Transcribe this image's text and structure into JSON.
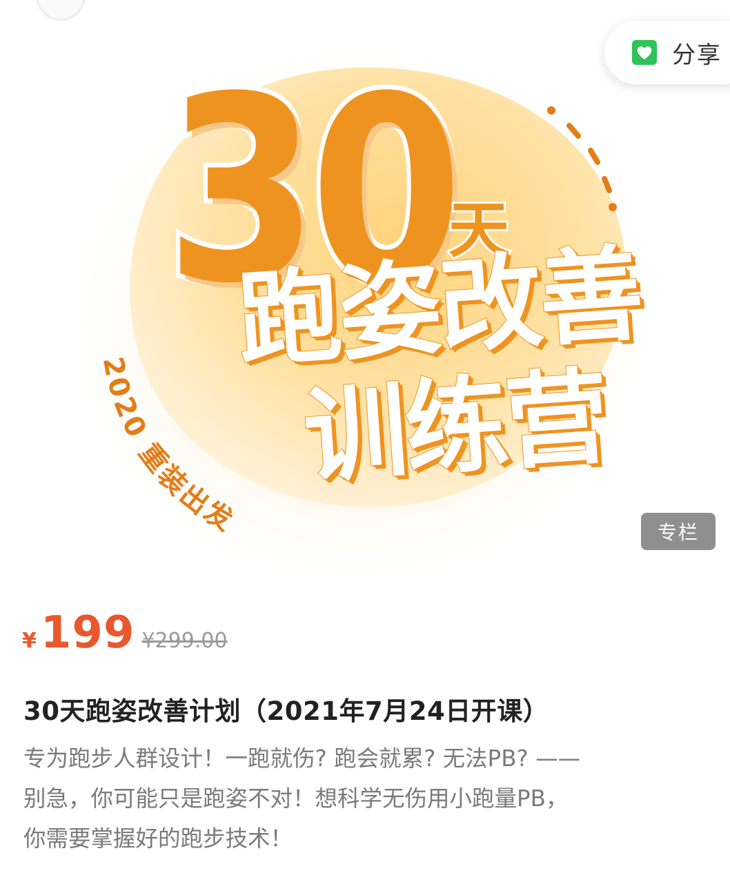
{
  "share": {
    "label": "分享",
    "icon": "green-heart-share-icon"
  },
  "poster": {
    "big_number": "30",
    "unit": "天",
    "line2": "跑姿改善",
    "line3": "训练营",
    "arc_text": "2020 重装出发"
  },
  "badge": "专栏",
  "price": {
    "currency": "¥",
    "current": "199",
    "original": "¥299.00"
  },
  "course": {
    "title": "30天跑姿改善计划（2021年7月24日开课）",
    "description_lines": [
      "专为跑步人群设计！一跑就伤? 跑会就累? 无法PB? ——",
      "别急，你可能只是跑姿不对！想科学无伤用小跑量PB，",
      "你需要掌握好的跑步技术！"
    ]
  },
  "colors": {
    "accent_orange": "#ef9320",
    "price_red": "#e8582c",
    "share_green": "#2fc25b"
  }
}
